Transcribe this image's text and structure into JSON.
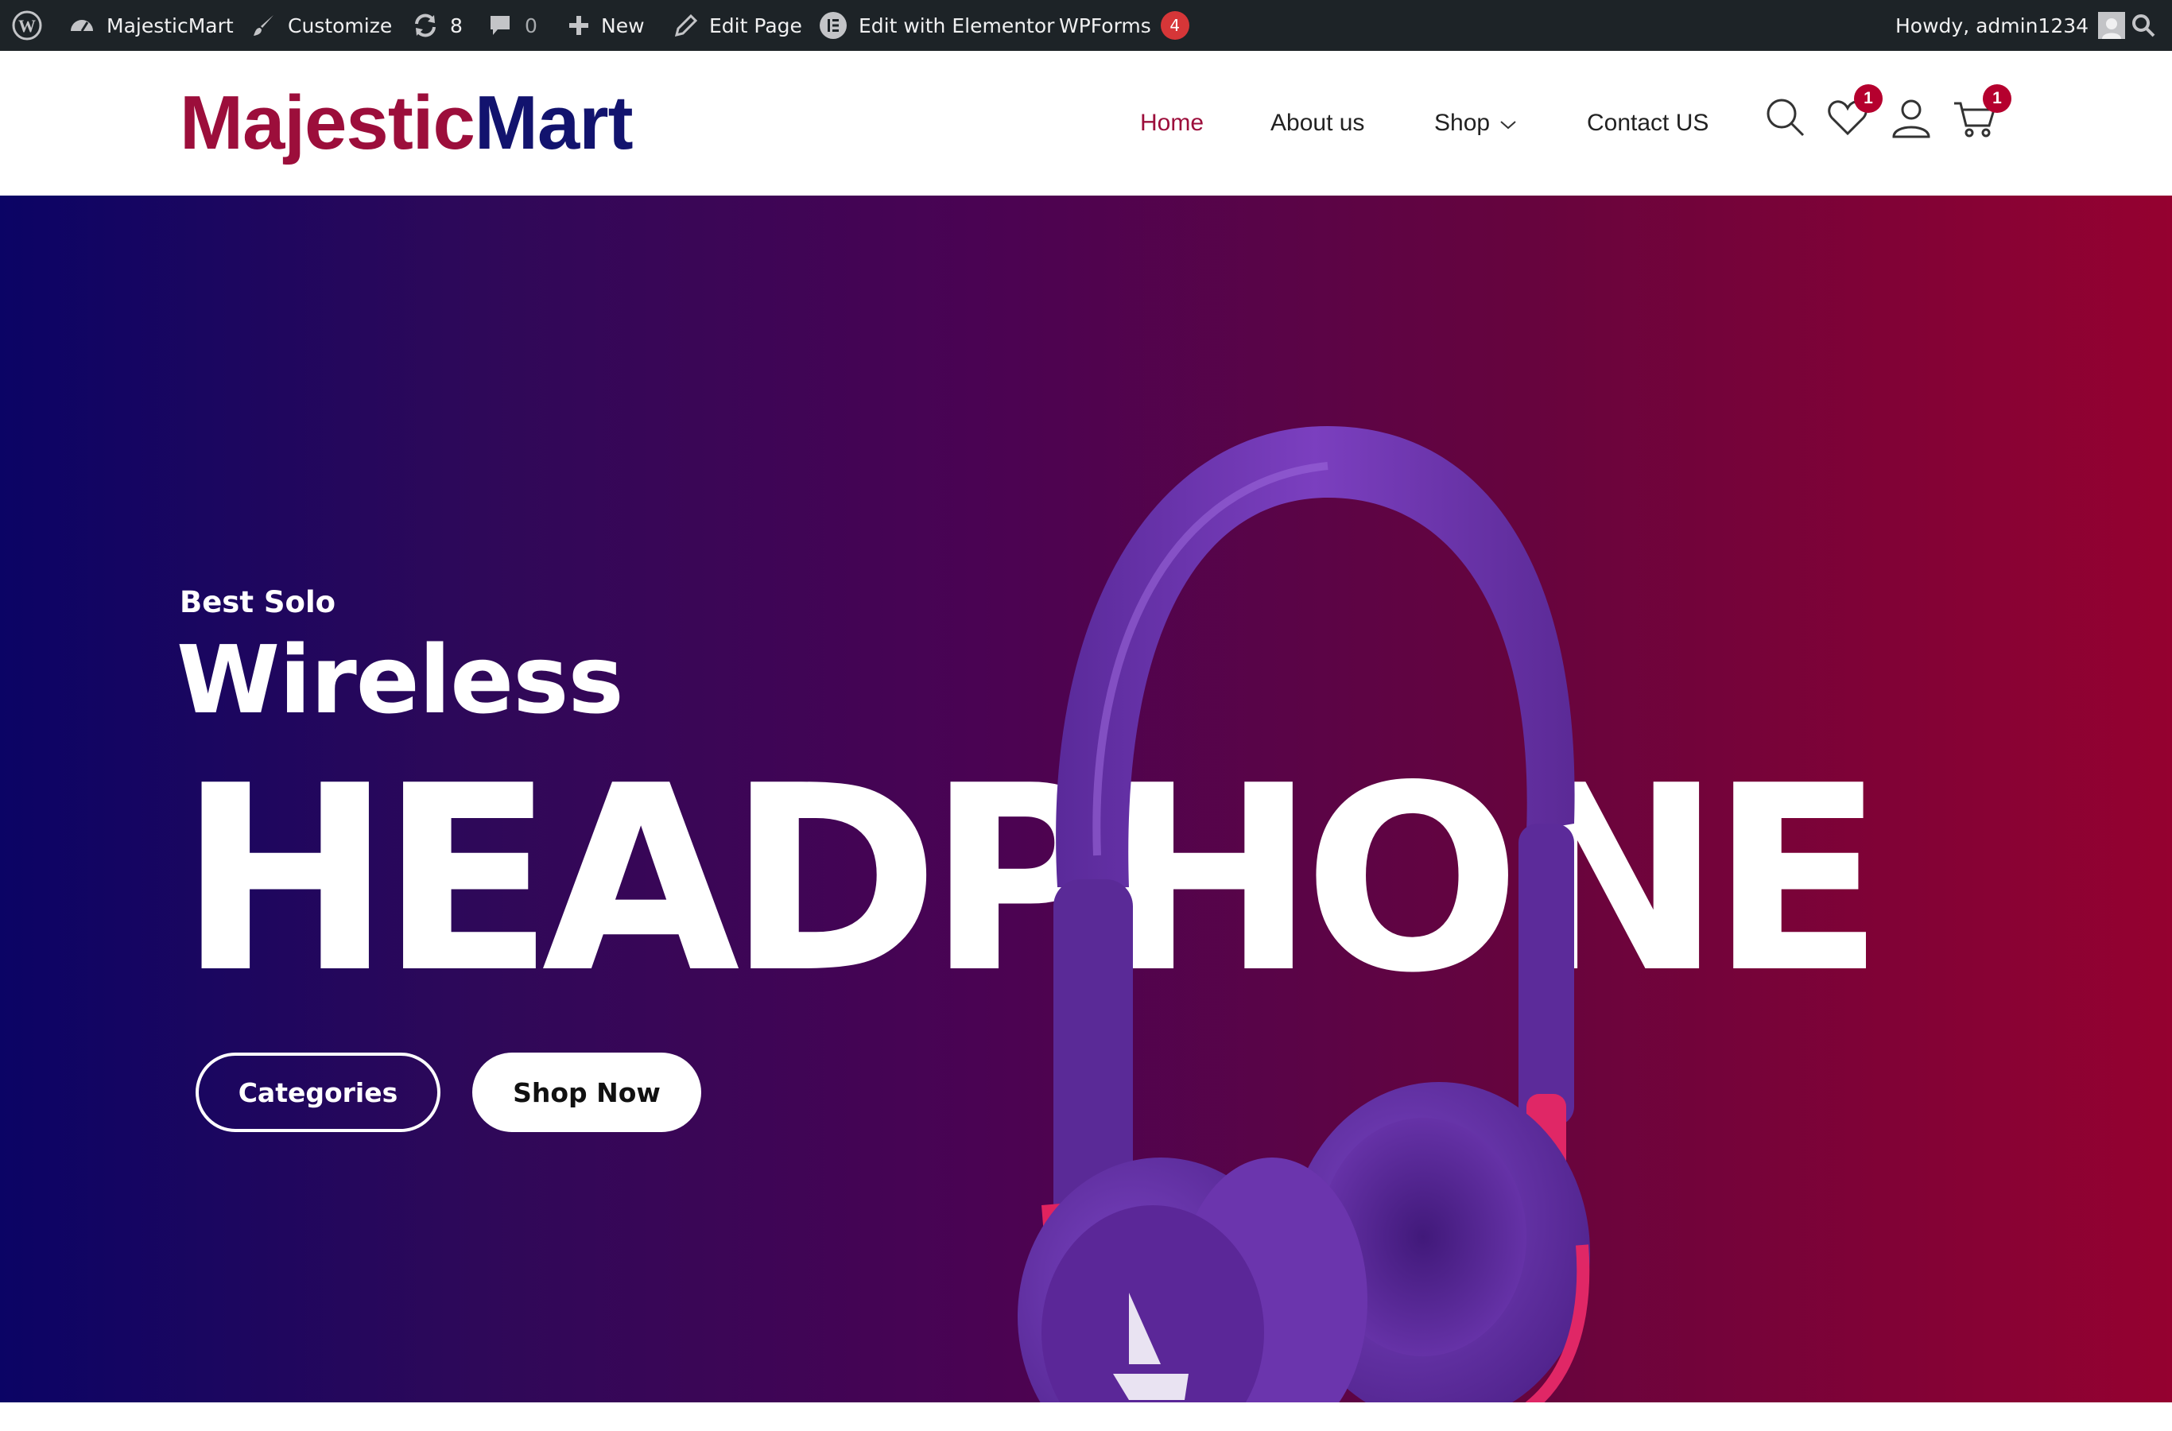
{
  "admin_bar": {
    "site_name": "MajesticMart",
    "customize": "Customize",
    "updates_count": "8",
    "comments_count": "0",
    "new": "New",
    "edit_page": "Edit Page",
    "edit_elementor": "Edit with Elementor",
    "wpforms": "WPForms",
    "wpforms_badge": "4",
    "howdy": "Howdy, admin1234"
  },
  "header": {
    "logo_part1": "Majestic",
    "logo_part2": "Mart",
    "nav": {
      "home": "Home",
      "about": "About us",
      "shop": "Shop",
      "contact": "Contact US"
    },
    "wishlist_count": "1",
    "cart_count": "1"
  },
  "hero": {
    "subtitle": "Best Solo",
    "title": "Wireless",
    "big_text": "HEADPHONE",
    "btn_categories": "Categories",
    "btn_shop_now": "Shop Now"
  },
  "colors": {
    "brand_red": "#9c0e3b",
    "brand_blue": "#12136e",
    "gradient_start": "#0b0465",
    "gradient_end": "#950130"
  }
}
